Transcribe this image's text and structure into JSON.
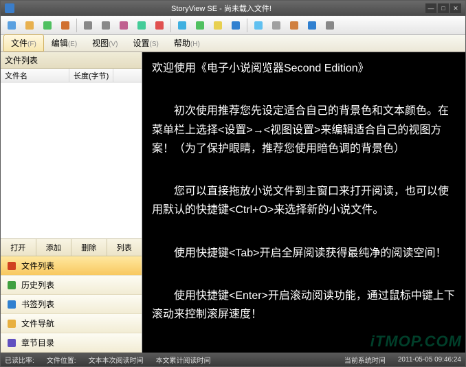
{
  "title": "StoryView SE - 尚未载入文件!",
  "winbuttons": {
    "min": "—",
    "max": "□",
    "close": "✕"
  },
  "menus": [
    {
      "label": "文件",
      "accel": "(F)"
    },
    {
      "label": "编辑",
      "accel": "(E)"
    },
    {
      "label": "视图",
      "accel": "(V)"
    },
    {
      "label": "设置",
      "accel": "(S)"
    },
    {
      "label": "帮助",
      "accel": "(H)"
    }
  ],
  "toolbar_icons": [
    "open",
    "folder",
    "refresh",
    "grid",
    "back",
    "forward",
    "print",
    "copy",
    "flag",
    "transfer",
    "cycle",
    "page",
    "save",
    "photo",
    "film",
    "book",
    "page2",
    "apple"
  ],
  "left": {
    "panel_title": "文件列表",
    "columns": [
      "文件名",
      "长度(字节)"
    ],
    "buttons": [
      "打开",
      "添加",
      "删除",
      "列表"
    ],
    "nav": [
      {
        "label": "文件列表",
        "color": "#d04020"
      },
      {
        "label": "历史列表",
        "color": "#40a040"
      },
      {
        "label": "书签列表",
        "color": "#3080d0"
      },
      {
        "label": "文件导航",
        "color": "#e8b040"
      },
      {
        "label": "章节目录",
        "color": "#6050c0"
      }
    ]
  },
  "reader_lines": [
    "欢迎使用《电子小说阅览器Second Edition》",
    "",
    "初次使用推荐您先设定适合自己的背景色和文本颜色。在菜单栏上选择<设置>→<视图设置>来编辑适合自己的视图方案！（为了保护眼睛，推荐您使用暗色调的背景色）",
    "",
    "您可以直接拖放小说文件到主窗口来打开阅读，也可以使用默认的快捷键<Ctrl+O>来选择新的小说文件。",
    "",
    "使用快捷键<Tab>开启全屏阅读获得最纯净的阅读空间！",
    "",
    "使用快捷键<Enter>开启滚动阅读功能，通过鼠标中键上下滚动来控制滚屏速度！"
  ],
  "status": {
    "read_rate_label": "已读比率:",
    "file_pos_label": "文件位置:",
    "session_time_label": "文本本次阅读时间",
    "total_time_label": "本文累计阅读时间",
    "systime_label": "当前系统时间",
    "systime_value": "2011-05-05 09:46:24"
  },
  "watermark": "iTMOP.COM"
}
